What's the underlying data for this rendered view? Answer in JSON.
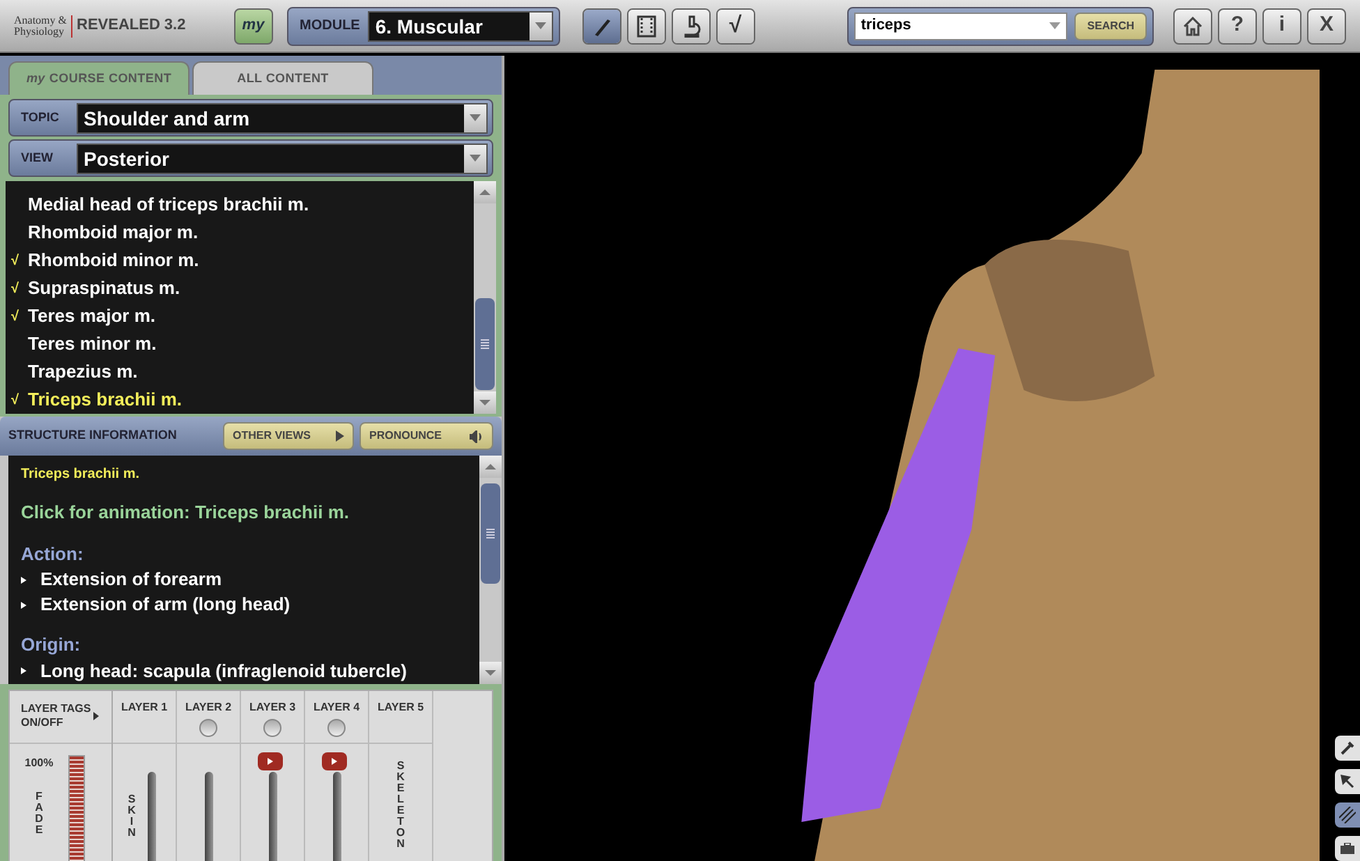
{
  "app": {
    "logo_small": "Anatomy & Physiology",
    "logo_name": "REVEALED",
    "logo_version": "3.2",
    "my_button": "my"
  },
  "module": {
    "label": "MODULE",
    "value": "6. Muscular"
  },
  "tools": [
    {
      "kind": "brush",
      "selected": true
    },
    {
      "kind": "film",
      "selected": false
    },
    {
      "kind": "microscope",
      "selected": false
    },
    {
      "kind": "check",
      "text": "√",
      "selected": false
    }
  ],
  "search": {
    "value": "triceps",
    "button": "SEARCH"
  },
  "nav_buttons": [
    {
      "kind": "home"
    },
    {
      "kind": "text",
      "text": "?"
    },
    {
      "kind": "text",
      "text": "i"
    },
    {
      "kind": "text",
      "text": "X"
    }
  ],
  "content_tabs": [
    {
      "prefix": "my",
      "label": "COURSE CONTENT",
      "selected": true
    },
    {
      "label": "ALL CONTENT",
      "selected": false
    }
  ],
  "topic": {
    "label": "TOPIC",
    "value": "Shoulder and arm"
  },
  "view": {
    "label": "VIEW",
    "value": "Posterior"
  },
  "structures": [
    {
      "name": "Medial head of triceps brachii m.",
      "checked": false,
      "selected": false
    },
    {
      "name": "Rhomboid major m.",
      "checked": false,
      "selected": false
    },
    {
      "name": "Rhomboid minor m.",
      "checked": true,
      "selected": false
    },
    {
      "name": "Supraspinatus m.",
      "checked": true,
      "selected": false
    },
    {
      "name": "Teres major m.",
      "checked": true,
      "selected": false
    },
    {
      "name": "Teres minor m.",
      "checked": false,
      "selected": false
    },
    {
      "name": "Trapezius m.",
      "checked": false,
      "selected": false
    },
    {
      "name": "Triceps brachii m.",
      "checked": true,
      "selected": true
    }
  ],
  "check_mark": "√",
  "structure_info": {
    "title": "STRUCTURE INFORMATION",
    "other_views": "OTHER VIEWS",
    "pronounce": "PRONOUNCE",
    "name": "Triceps brachii m.",
    "animation_link": "Click for animation: Triceps brachii m.",
    "sections": [
      {
        "heading": "Action:",
        "items": [
          "Extension of forearm",
          "Extension of arm (long head)"
        ]
      },
      {
        "heading": "Origin:",
        "items": [
          "Long head: scapula (infraglenoid tubercle)"
        ]
      }
    ]
  },
  "layer_tags": {
    "label": "LAYER TAGS ON/OFF",
    "fade_reading": "100%",
    "fade_label": "FADE",
    "fade_meter": {
      "level": 1
    }
  },
  "layers": [
    {
      "label": "LAYER 1",
      "toggle": false,
      "thumb": false,
      "tag": "SKIN",
      "level": 1
    },
    {
      "label": "LAYER 2",
      "toggle": true,
      "thumb": false,
      "level": 1
    },
    {
      "label": "LAYER 3",
      "toggle": true,
      "thumb": true,
      "level": 1
    },
    {
      "label": "LAYER 4",
      "toggle": true,
      "thumb": true,
      "level": 1
    },
    {
      "label": "LAYER 5",
      "toggle": false,
      "thumb": false,
      "tag": "SKELETON"
    }
  ],
  "side_tools": [
    {
      "kind": "pipette",
      "selected": false
    },
    {
      "kind": "arrow",
      "selected": false
    },
    {
      "kind": "hatch",
      "selected": true
    },
    {
      "kind": "case",
      "selected": false
    }
  ]
}
